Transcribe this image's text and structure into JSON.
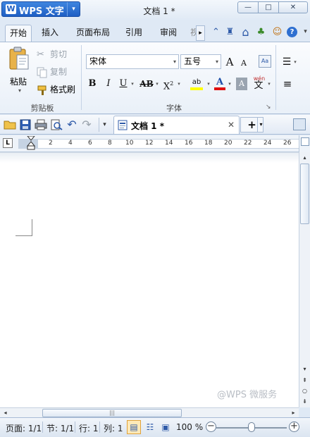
{
  "app": {
    "menu_label": "WPS 文字",
    "logo_letter": "W",
    "menu_dropdown": "▾",
    "window_title": "文档 1 *"
  },
  "window_controls": {
    "minimize": "—",
    "maximize": "□",
    "close": "✕"
  },
  "tabs": [
    {
      "label": "开始",
      "active": true
    },
    {
      "label": "插入"
    },
    {
      "label": "页面布局"
    },
    {
      "label": "引用"
    },
    {
      "label": "审阅"
    },
    {
      "label": "视"
    }
  ],
  "tabs_more": "▸",
  "quick_icons": [
    "caret-up-icon",
    "shirt-skin-icon",
    "home-icon",
    "community-icon",
    "user-avatar-icon",
    "help-icon",
    "dropdown-icon"
  ],
  "quick_glyphs": {
    "caret": "⌃",
    "shirt": "♜",
    "home": "⌂",
    "community": "♣",
    "user": "☺",
    "help": "?",
    "dropdown": "▾"
  },
  "clipboard": {
    "paste_label": "粘贴",
    "paste_dropdown": "▾",
    "cut_label": "剪切",
    "copy_label": "复制",
    "format_painter_label": "格式刷",
    "group_label": "剪贴板"
  },
  "font": {
    "font_name": "宋体",
    "font_size": "五号",
    "dropdown": "▾",
    "grow_label": "A",
    "shrink_label": "A",
    "bold": "B",
    "italic": "I",
    "underline": "U",
    "strikethrough": "AB",
    "superscript": "X",
    "superscript_mark": "2",
    "highlight_label": "ab",
    "font_color_label": "A",
    "char_shading_label": "A",
    "phonetic_label": "文",
    "phonetic_top": "wén",
    "group_label": "字体",
    "launcher": "↘"
  },
  "paragraph": {
    "list_label": "☰",
    "align_label": "≡",
    "dropdown": "▾"
  },
  "colors": {
    "highlight": "#ffff00",
    "font_color": "#e01010",
    "accent": "#1f5fc4"
  },
  "document_tab": {
    "label": "文档 1 *",
    "close": "✕"
  },
  "toolbar": {
    "new_tab": "+",
    "new_tab_dropdown": "▾",
    "more": "▾",
    "undo": "↶",
    "redo": "↷"
  },
  "ruler": {
    "corner": "L",
    "ticks": [
      "2",
      "4",
      "6",
      "8",
      "10",
      "12",
      "14",
      "16",
      "18",
      "20",
      "22",
      "24",
      "26"
    ]
  },
  "watermark": "@WPS 微服务",
  "scrollbar": {
    "up": "▴",
    "down": "▾",
    "prev_page": "⇞",
    "select_browse": "○",
    "next_page": "⇟",
    "left": "◂",
    "right": "▸",
    "grip": "|||"
  },
  "status": {
    "page": "页面: 1/1",
    "section": "节: 1/1",
    "line": "行: 1",
    "column": "列: 1",
    "zoom": "100 %",
    "zoom_out": "−",
    "zoom_in": "+",
    "zoom_level": 0.5
  }
}
